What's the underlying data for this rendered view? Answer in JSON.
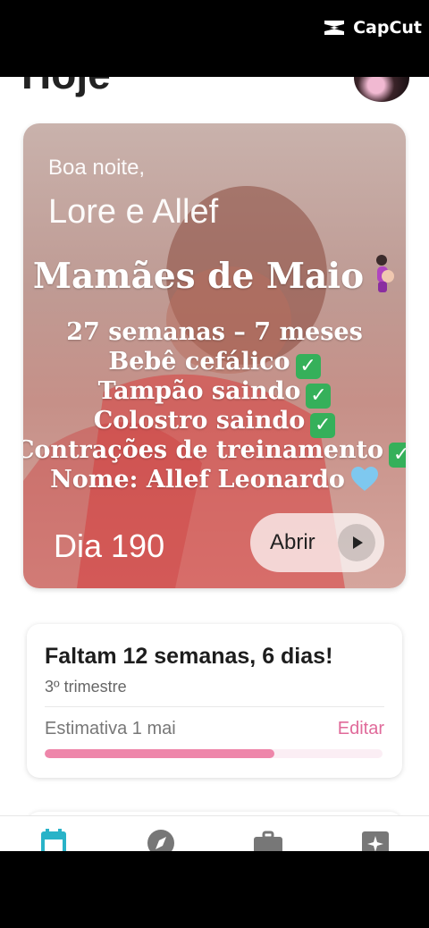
{
  "watermark": {
    "label": "CapCut"
  },
  "header": {
    "title": "Hoje"
  },
  "hero": {
    "greeting": "Boa noite,",
    "names": "Lore e Allef",
    "overlay_title": "Mamães de Maio",
    "overlay_lines": [
      "27 semanas – 7 meses",
      "Bebê cefálico",
      "Tampão saindo",
      "Colostro saindo",
      "Contrações de treinamento",
      "Nome: Allef Leonardo"
    ],
    "day_label": "Dia 190",
    "open_label": "Abrir"
  },
  "countdown": {
    "title": "Faltam 12 semanas, 6 dias!",
    "trimester": "3º trimestre",
    "estimate": "Estimativa 1 mai",
    "edit_label": "Editar",
    "progress_percent": 68
  },
  "bottom_nav": {
    "items": [
      "calendar-icon",
      "compass-icon",
      "briefcase-icon",
      "sparkle-icon"
    ],
    "active_color": "#29b3c8"
  },
  "colors": {
    "accent_pink": "#e06a9a",
    "progress_pink": "#ee86aa",
    "nav_active": "#29b3c8",
    "check_green": "#35b05a"
  }
}
